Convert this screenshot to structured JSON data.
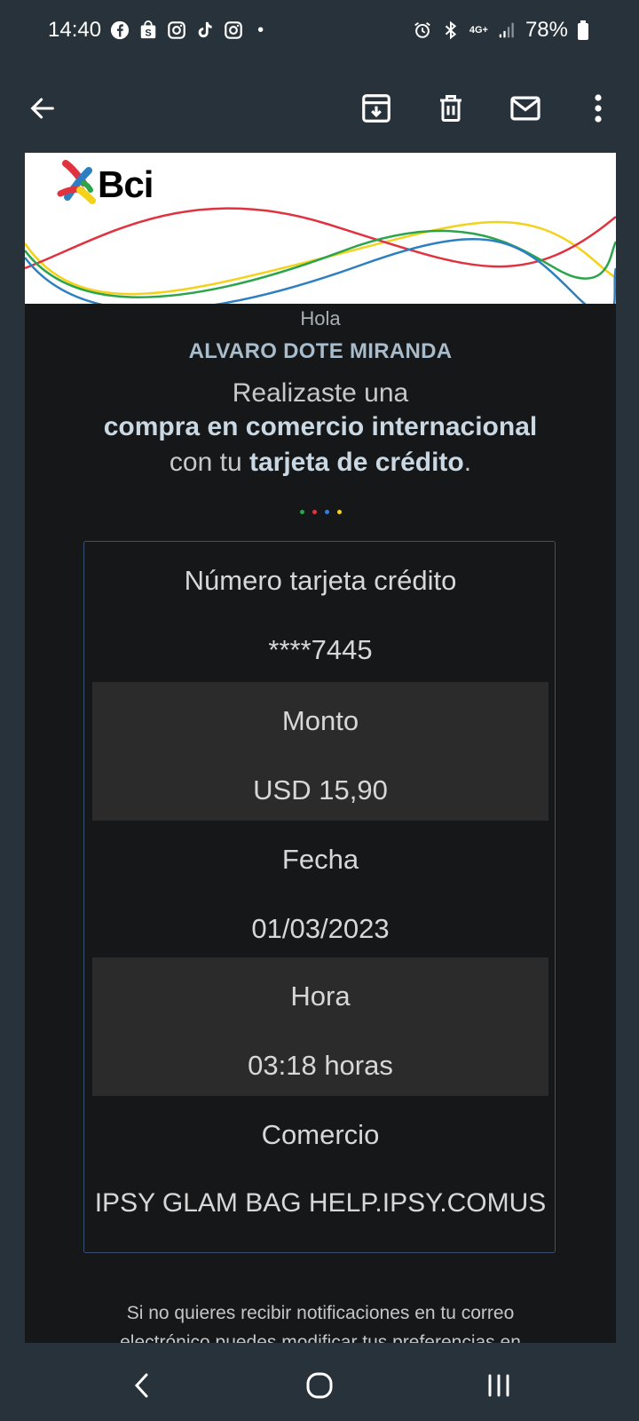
{
  "status_bar": {
    "time": "14:40",
    "dot": "•",
    "network": "4G+",
    "battery": "78%",
    "icons_left": [
      "facebook-icon",
      "shop-icon",
      "instagram-icon",
      "tiktok-icon",
      "instagram-icon"
    ],
    "icons_right": [
      "alarm-icon",
      "bluetooth-icon",
      "network-icon",
      "signal-icon",
      "battery-icon"
    ]
  },
  "toolbar": {
    "icons": [
      "back-arrow-icon",
      "archive-icon",
      "delete-icon",
      "mail-icon",
      "more-vert-icon"
    ]
  },
  "email": {
    "brand": "Bci",
    "hola": "Hola",
    "name": "ALVARO DOTE MIRANDA",
    "line1": "Realizaste una",
    "line2": "compra en comercio internacional",
    "line3_prefix": "con tu ",
    "line3_bold": "tarjeta de crédito",
    "line3_suffix": ".",
    "dot_colors": [
      "#2aa54a",
      "#e0333f",
      "#3a7bd5",
      "#f4d21c"
    ],
    "fields": [
      {
        "label": "Número tarjeta crédito",
        "value": "****7445"
      },
      {
        "label": "Monto",
        "value": "USD 15,90"
      },
      {
        "label": "Fecha",
        "value": "01/03/2023"
      },
      {
        "label": "Hora",
        "value": "03:18 horas"
      },
      {
        "label": "Comercio",
        "value": "IPSY GLAM BAG HELP.IPSY.COMUS"
      }
    ],
    "footer_line1": "Si no quieres recibir notificaciones en tu correo",
    "footer_line2": "electrónico puedes modificar tus preferencias en"
  },
  "nav_bar": {
    "icons": [
      "back-icon",
      "home-icon",
      "recents-icon"
    ]
  },
  "colors": {
    "background": "#161718",
    "bars": "#27323a",
    "card_border": "#3a4f74",
    "shaded_row": "#2b2b2b",
    "wave_yellow": "#f4d21c",
    "wave_red": "#e0333f",
    "wave_green": "#2aa54a",
    "wave_blue": "#2d7fc1"
  }
}
